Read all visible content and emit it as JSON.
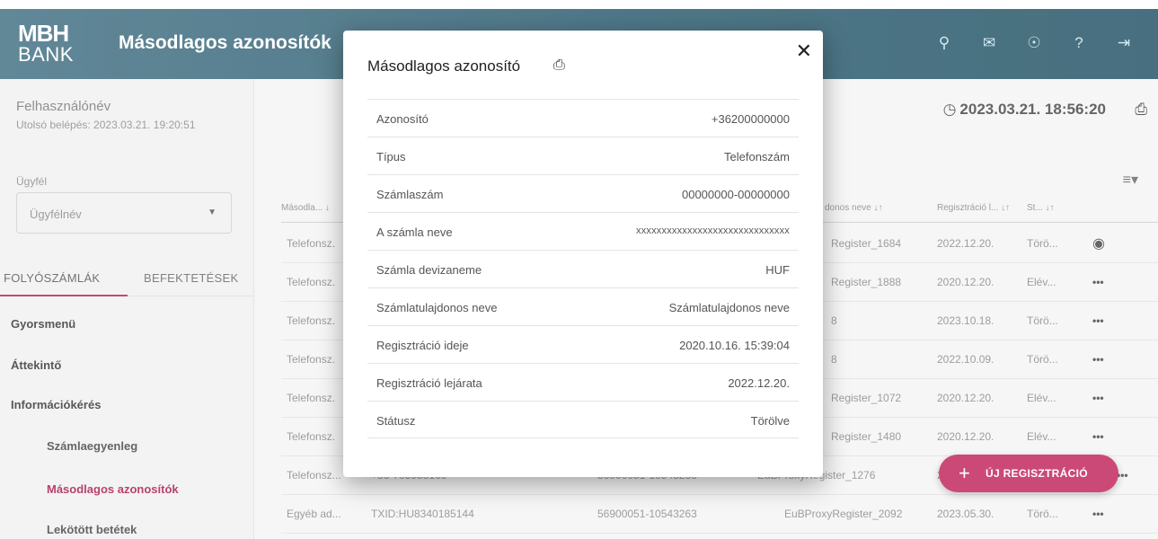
{
  "header": {
    "logo_line1": "MBH",
    "logo_line2": "BANK",
    "title": "Másodlagos azonosítók",
    "icons": [
      "search-icon",
      "mail-icon",
      "globe-icon",
      "help-icon",
      "logout-icon"
    ]
  },
  "sidebar": {
    "username": "Felhasználónév",
    "last_login": "Utolsó belépés: 2023.03.21. 19:20:51",
    "client_label": "Ügyfél",
    "client_value": "Ügyfélnév",
    "tabs": [
      "FOLYÓSZÁMLÁK",
      "BEFEKTETÉSEK"
    ],
    "menu": [
      {
        "label": "Gyorsmenü"
      },
      {
        "label": "Áttekintő"
      },
      {
        "label": "Információkérés"
      },
      {
        "label": "Számlaegyenleg"
      },
      {
        "label": "Másodlagos azonosítók"
      },
      {
        "label": "Lekötött betétek"
      }
    ]
  },
  "main": {
    "datetime": "2023.03.21. 18:56:20",
    "columns": [
      "Másodla... ↓",
      "donos neve ↓↑",
      "Regisztráció l... ↓↑",
      "St... ↓↑"
    ],
    "rows": [
      {
        "type": "Telefonsz.",
        "id": "",
        "account": "",
        "owner": "Register_1684",
        "date": "2022.12.20.",
        "status": "Törö...",
        "action": "eye"
      },
      {
        "type": "Telefonsz.",
        "id": "",
        "account": "",
        "owner": "Register_1888",
        "date": "2020.12.20.",
        "status": "Elév...",
        "action": "•••"
      },
      {
        "type": "Telefonsz.",
        "id": "",
        "account": "",
        "owner": "8",
        "date": "2023.10.18.",
        "status": "Törö...",
        "action": "•••"
      },
      {
        "type": "Telefonsz.",
        "id": "",
        "account": "",
        "owner": "8",
        "date": "2022.10.09.",
        "status": "Törö...",
        "action": "•••"
      },
      {
        "type": "Telefonsz.",
        "id": "",
        "account": "",
        "owner": "Register_1072",
        "date": "2020.12.20.",
        "status": "Elév...",
        "action": "•••"
      },
      {
        "type": "Telefonsz.",
        "id": "",
        "account": "",
        "owner": "Register_1480",
        "date": "2020.12.20.",
        "status": "Elév...",
        "action": "•••"
      },
      {
        "type": "Telefonsz...",
        "id": "+36-705958169",
        "account": "56900051-10543263",
        "owner": "EuBProxyRegister_1276",
        "date": "2",
        "status": "",
        "action": "•••"
      },
      {
        "type": "Egyéb ad...",
        "id": "TXID:HU8340185144",
        "account": "56900051-10543263",
        "owner": "EuBProxyRegister_2092",
        "date": "2023.05.30.",
        "status": "Törö...",
        "action": "•••"
      }
    ],
    "fab_label": "ÚJ REGISZTRÁCIÓ"
  },
  "modal": {
    "title": "Másodlagos azonosító",
    "fields": [
      {
        "label": "Azonosító",
        "value": "+36200000000"
      },
      {
        "label": "Típus",
        "value": "Telefonszám"
      },
      {
        "label": "Számlaszám",
        "value": "00000000-00000000"
      },
      {
        "label": "A számla neve",
        "value": "xxxxxxxxxxxxxxxxxxxxxxxxxxxxxx"
      },
      {
        "label": "Számla devizaneme",
        "value": "HUF"
      },
      {
        "label": "Számlatulajdonos neve",
        "value": "Számlatulajdonos neve"
      },
      {
        "label": "Regisztráció ideje",
        "value": "2020.10.16. 15:39:04"
      },
      {
        "label": "Regisztráció lejárata",
        "value": "2022.12.20."
      },
      {
        "label": "Státusz",
        "value": "Törölve"
      }
    ]
  },
  "colors": {
    "header": "#27596d",
    "accent": "#c0225a",
    "active_nav": "#a8184d"
  }
}
